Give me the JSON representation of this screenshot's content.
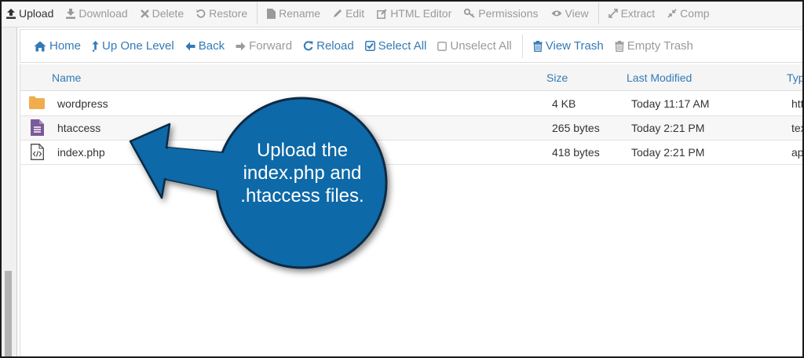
{
  "toolbar": {
    "upload": "Upload",
    "download": "Download",
    "delete": "Delete",
    "restore": "Restore",
    "rename": "Rename",
    "edit": "Edit",
    "html_editor": "HTML Editor",
    "permissions": "Permissions",
    "view": "View",
    "extract": "Extract",
    "compress": "Comp"
  },
  "nav": {
    "home": "Home",
    "up_one_level": "Up One Level",
    "back": "Back",
    "forward": "Forward",
    "reload": "Reload",
    "select_all": "Select All",
    "unselect_all": "Unselect All",
    "view_trash": "View Trash",
    "empty_trash": "Empty Trash"
  },
  "table": {
    "columns": {
      "name": "Name",
      "size": "Size",
      "last_modified": "Last Modified",
      "type": "Typ"
    },
    "rows": [
      {
        "name": "wordpress",
        "size": "4 KB",
        "modified": "Today 11:17 AM",
        "type": "htt",
        "icon": "folder-icon"
      },
      {
        "name": "htaccess",
        "size": "265 bytes",
        "modified": "Today 2:21 PM",
        "type": "tex",
        "icon": "text-file-icon"
      },
      {
        "name": "index.php",
        "size": "418 bytes",
        "modified": "Today 2:21 PM",
        "type": "ap",
        "icon": "code-file-icon"
      }
    ]
  },
  "callout": {
    "line1": "Upload the",
    "line2": "index.php and",
    "line3": ".htaccess files."
  },
  "colors": {
    "link": "#337ab7",
    "disabled": "#9a9a9a",
    "callout_fill": "#1169a7",
    "callout_border": "#0b2a44",
    "folder": "#f0ad4e",
    "text_file": "#7a5a9a"
  }
}
